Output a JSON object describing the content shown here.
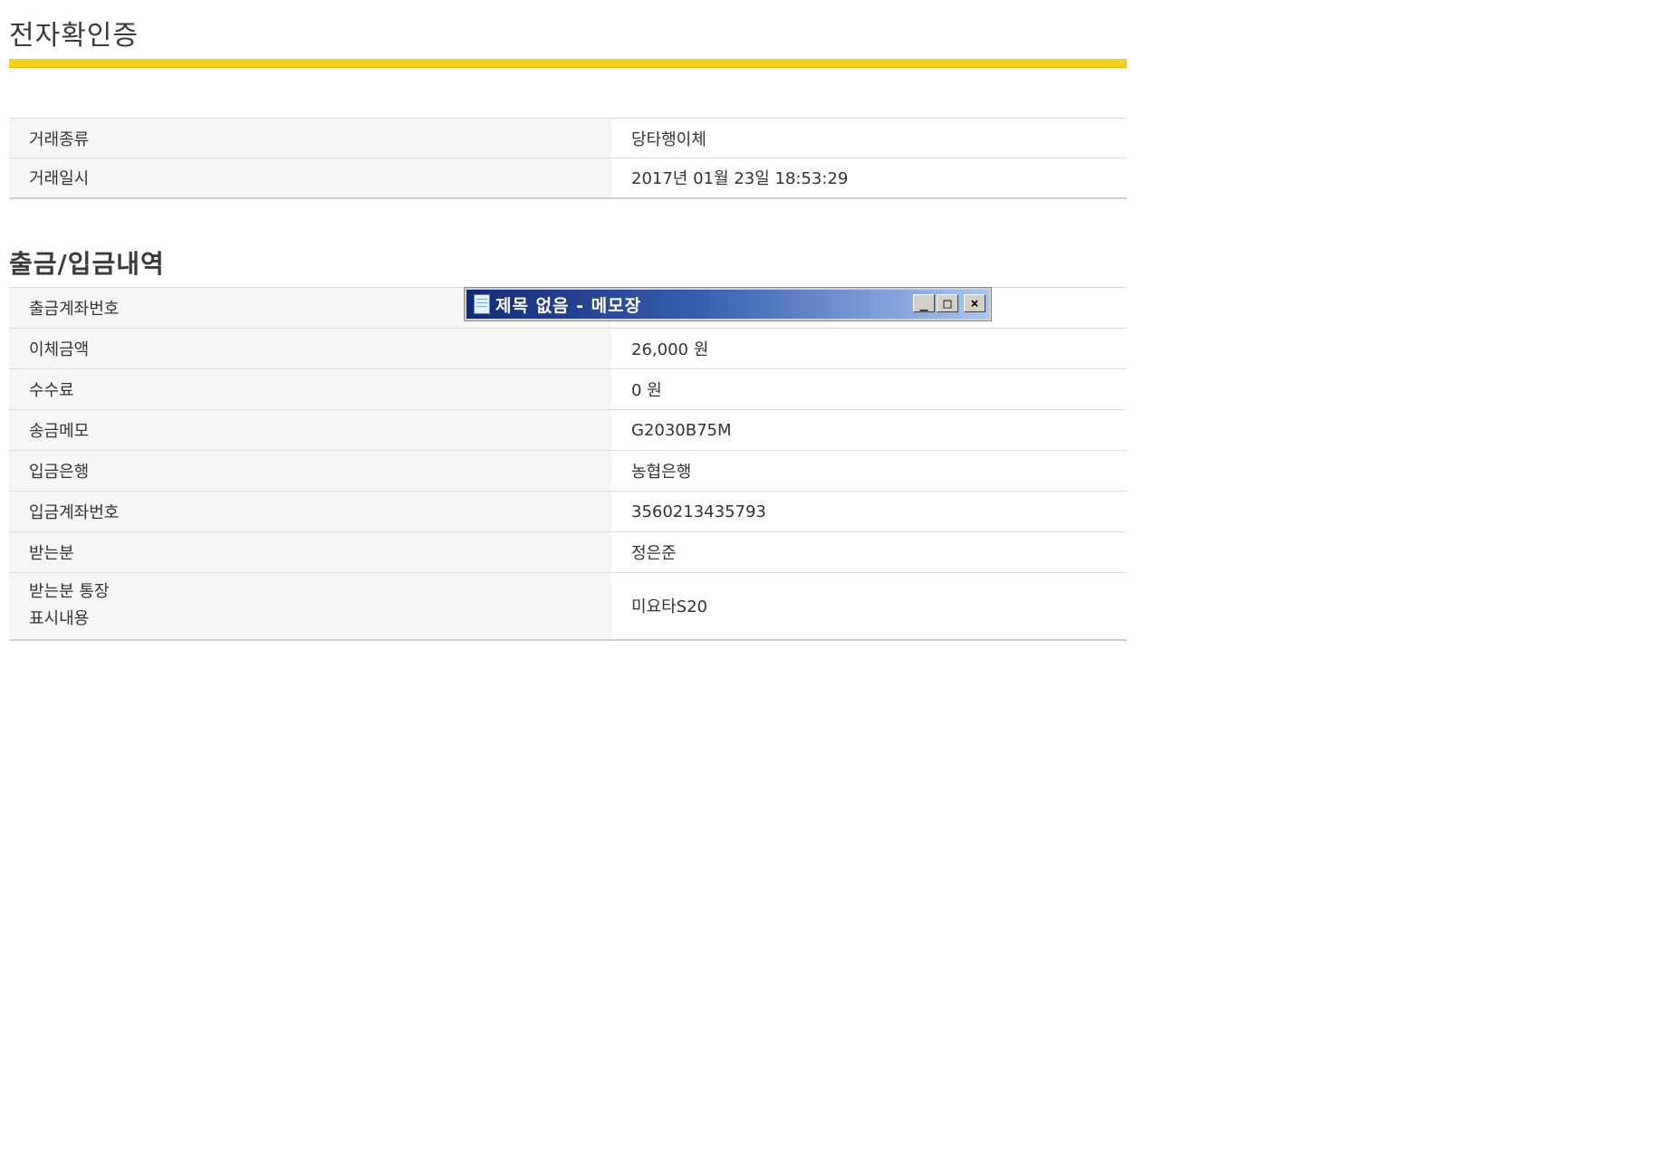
{
  "page": {
    "title": "전자확인증"
  },
  "transaction": {
    "rows": [
      {
        "label": "거래종류",
        "value": "당타행이체"
      },
      {
        "label": "거래일시",
        "value": "2017년 01월 23일 18:53:29"
      }
    ]
  },
  "details": {
    "title": "출금/입금내역",
    "rows": [
      {
        "label": "출금계좌번호",
        "value": ""
      },
      {
        "label": "이체금액",
        "value": "26,000 원"
      },
      {
        "label": "수수료",
        "value": "0 원"
      },
      {
        "label": "송금메모",
        "value": "G2030B75M"
      },
      {
        "label": "입금은행",
        "value": "농협은행"
      },
      {
        "label": "입금계좌번호",
        "value": "3560213435793"
      },
      {
        "label": "받는분",
        "value": "정은준"
      },
      {
        "label_line1": "받는분 통장",
        "label_line2": "표시내용",
        "value": "미요타S20"
      }
    ]
  },
  "notepad": {
    "title": "제목 없음 - 메모장",
    "icon": "notepad-icon",
    "minimize": "_",
    "maximize": "□",
    "close": "×"
  },
  "colors": {
    "accent_bar": "#f6d21e",
    "label_bg": "#f6f6f4",
    "titlebar_start": "#102a75",
    "titlebar_end": "#a6c6ef"
  }
}
